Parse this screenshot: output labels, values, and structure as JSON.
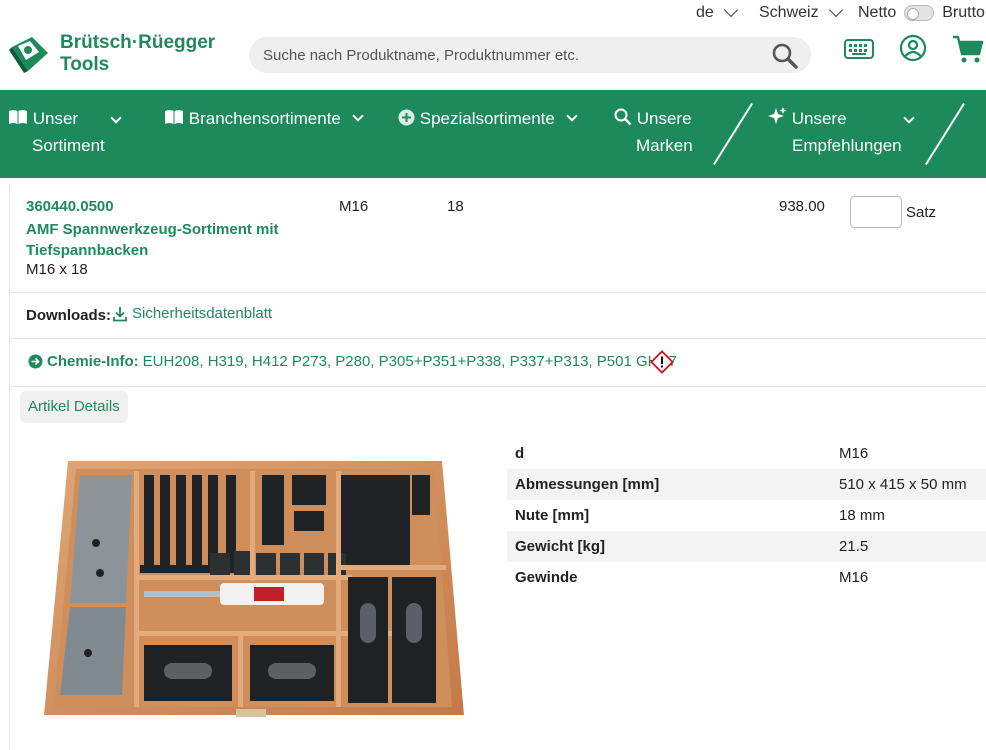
{
  "topbar": {
    "language": "de",
    "country": "Schweiz",
    "netto_label": "Netto",
    "brutto_label": "Brutto"
  },
  "header": {
    "brand_line1": "Brütsch·Rüegger",
    "brand_line2": "Tools",
    "search_placeholder": "Suche nach Produktname, Produktnummer etc."
  },
  "nav": {
    "items": [
      {
        "label_line1": "Unser",
        "label_line2": "Sortiment",
        "icon": "book-icon"
      },
      {
        "label_line1": "Branchensortimente",
        "icon": "book-icon"
      },
      {
        "label_line1": "Spezialsortimente",
        "icon": "plus-circle-icon"
      },
      {
        "label_line1": "Unsere",
        "label_line2": "Marken",
        "icon": "search-icon"
      },
      {
        "label_line1": "Unsere",
        "label_line2": "Empfehlungen",
        "icon": "sparkle-icon"
      }
    ]
  },
  "product": {
    "article_number": "360440.0500",
    "name": "AMF Spannwerkzeug-Sortiment mit Tiefspannbacken",
    "subtitle": "M16 x 18",
    "thread": "M16",
    "slot": "18",
    "price": "938.00",
    "quantity_value": "",
    "unit": "Satz"
  },
  "downloads": {
    "label": "Downloads:",
    "link": "Sicherheitsdatenblatt"
  },
  "chemie": {
    "label": "Chemie-Info:",
    "text": "EUH208, H319, H412 P273, P280, P305+P351+P338, P337+P313, P501 GHS7"
  },
  "tabs": {
    "details_label": "Artikel Details"
  },
  "specs": [
    {
      "key": "d",
      "value": "M16"
    },
    {
      "key": "Abmessungen [mm]",
      "value": "510 x 415 x 50 mm"
    },
    {
      "key": "Nute [mm]",
      "value": "18 mm"
    },
    {
      "key": "Gewicht [kg]",
      "value": "21.5"
    },
    {
      "key": "Gewinde",
      "value": "M16"
    }
  ],
  "colors": {
    "brand_green": "#1c8a5b",
    "link_green": "#1f8a5e"
  }
}
